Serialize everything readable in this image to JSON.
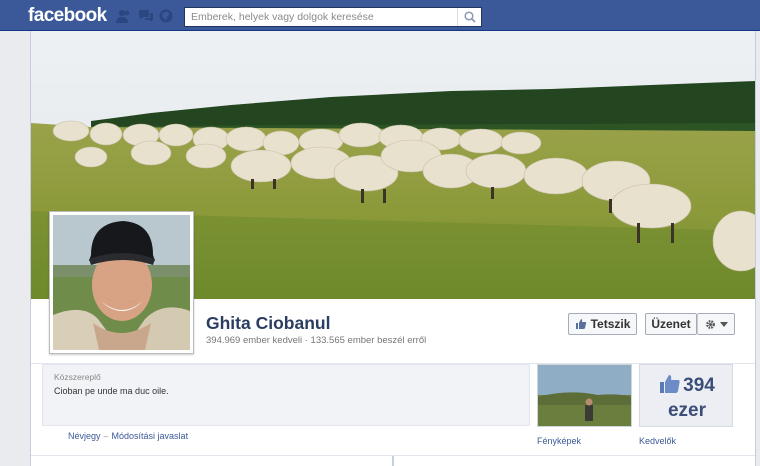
{
  "app": {
    "logo": "facebook",
    "brand_color": "#3b5998"
  },
  "topbar": {
    "jewels": [
      "friend-requests-icon",
      "messages-icon",
      "notifications-icon"
    ],
    "search": {
      "placeholder": "Emberek, helyek vagy dolgok keresése",
      "value": "",
      "icon": "search-icon"
    }
  },
  "page": {
    "name": "Ghita Ciobanul",
    "stats": "394.969 ember kedveli · 133.565 ember beszél erről",
    "actions": {
      "like_label": "Tetszik",
      "like_icon": "thumbs-up-icon",
      "message_label": "Üzenet",
      "settings_icon": "gear-icon",
      "dropdown_icon": "caret-down-icon"
    },
    "about": {
      "category": "Közszereplő",
      "description": "Cioban pe unde ma duc oile.",
      "link_info": "Névjegy",
      "link_separator": "–",
      "link_suggest": "Módosítási javaslat"
    },
    "apps": {
      "photos_label": "Fényképek",
      "likes_count": "394",
      "likes_unit": "ezer",
      "likes_label": "Kedvelők"
    }
  }
}
